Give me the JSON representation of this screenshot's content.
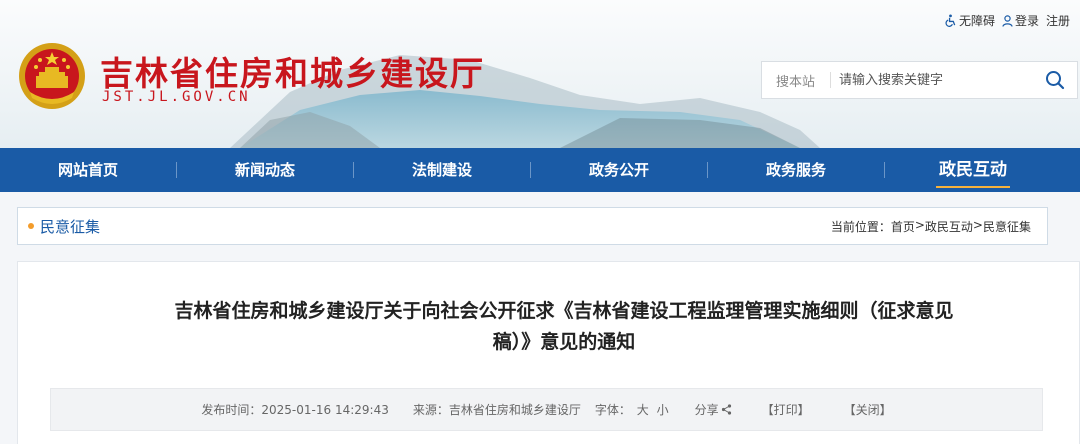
{
  "header": {
    "toplinks": {
      "accessibility": "无障碍",
      "login": "登录",
      "register": "注册"
    },
    "site_title": "吉林省住房和城乡建设厅",
    "domain": "JST.JL.GOV.CN",
    "search": {
      "scope": "搜本站",
      "placeholder": "请输入搜索关键字"
    }
  },
  "nav": {
    "items": [
      {
        "label": "网站首页"
      },
      {
        "label": "新闻动态"
      },
      {
        "label": "法制建设"
      },
      {
        "label": "政务公开"
      },
      {
        "label": "政务服务"
      },
      {
        "label": "政民互动"
      }
    ],
    "active_index": 5
  },
  "breadcrumb": {
    "section": "民意征集",
    "prefix": "当前位置：",
    "path": [
      "首页",
      "政民互动",
      "民意征集"
    ],
    "separator": ">"
  },
  "article": {
    "title": "吉林省住房和城乡建设厅关于向社会公开征求《吉林省建设工程监理管理实施细则（征求意见稿）》意见的通知",
    "publish_label": "发布时间：",
    "publish_time": "2025-01-16 14:29:43",
    "source_label": "来源：",
    "source": "吉林省住房和城乡建设厅",
    "font_label": "字体：",
    "font_large": "大",
    "font_small": "小",
    "share": "分享",
    "print": "【打印】",
    "close": "【关闭】"
  },
  "colors": {
    "brand_red": "#c8161d",
    "nav_blue": "#1a5ba6",
    "accent_orange": "#f39c2b"
  }
}
